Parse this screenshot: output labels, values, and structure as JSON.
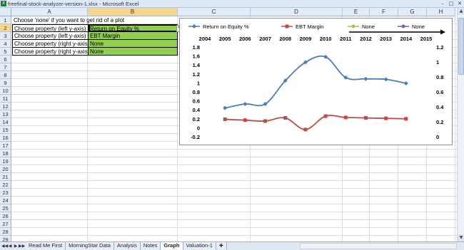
{
  "window": {
    "title": "freefinal-stock-analyzer-version-1.xlsx - Microsoft Excel",
    "app_icon": "excel-icon"
  },
  "columns": [
    "A",
    "B",
    "C",
    "D",
    "E",
    "F",
    "G",
    "H"
  ],
  "selected_column": "B",
  "selected_row": 2,
  "rows": [
    "1",
    "2",
    "3",
    "4",
    "5",
    "6",
    "7",
    "8",
    "9",
    "10",
    "11",
    "12",
    "13",
    "14",
    "15",
    "16",
    "17",
    "18",
    "19",
    "20",
    "21",
    "22",
    "23",
    "24",
    "25",
    "26",
    "27",
    "28",
    "29"
  ],
  "sheet": {
    "note": "Choose 'none' if you want to get rid of a plot",
    "properties": [
      {
        "label": "Choose property (left y-axis)",
        "value": "Return on Equity %"
      },
      {
        "label": "Choose property (left y-axis)",
        "value": "EBT Margin"
      },
      {
        "label": "Choose property (right y-axis)",
        "value": "None"
      },
      {
        "label": "Choose property (right y-axis)",
        "value": "None"
      }
    ]
  },
  "tabs": [
    "Read Me First",
    "MorningStar Data",
    "Analysis",
    "Notes",
    "Graph",
    "Valuation-1"
  ],
  "active_tab": "Graph",
  "colors": {
    "roe": "#4a7ebb",
    "ebt": "#be4b48",
    "none1": "#98c654",
    "none2": "#7d60a0",
    "green_cell": "#92cf50"
  },
  "chart_data": {
    "type": "line",
    "x_top": [
      "2004",
      "2005",
      "2006",
      "2007",
      "2008",
      "2009",
      "2010",
      "2011",
      "2012",
      "2013",
      "2014",
      "2015"
    ],
    "x": [
      "2005",
      "2006",
      "2007",
      "2008",
      "2009",
      "2010",
      "2011",
      "2012",
      "2013",
      "2014"
    ],
    "series": [
      {
        "name": "Return on Equity %",
        "axis": "left",
        "color": "#4a7ebb",
        "marker": "diamond",
        "values": [
          0.44,
          0.53,
          0.53,
          1.05,
          1.46,
          1.58,
          1.12,
          1.09,
          1.08,
          0.99
        ]
      },
      {
        "name": "EBT Margin",
        "axis": "left",
        "color": "#be4b48",
        "marker": "square",
        "values": [
          0.19,
          0.17,
          0.15,
          0.22,
          -0.04,
          0.26,
          0.23,
          0.22,
          0.21,
          0.2
        ]
      },
      {
        "name": "None",
        "axis": "right",
        "color": "#98c654",
        "marker": "circle",
        "values": []
      },
      {
        "name": "None",
        "axis": "right",
        "color": "#7d60a0",
        "marker": "circle",
        "values": []
      }
    ],
    "left_ticks": [
      "1.8",
      "1.6",
      "1.4",
      "1.2",
      "1",
      "0.8",
      "0.6",
      "0.4",
      "0.2",
      "0",
      "-0.2"
    ],
    "right_ticks": [
      "1.2",
      "1",
      "0.8",
      "0.6",
      "0.4",
      "0.2",
      "0"
    ],
    "ylim_left": [
      -0.2,
      1.8
    ],
    "ylim_right": [
      0,
      1.2
    ],
    "legend": "top",
    "grid": false
  }
}
